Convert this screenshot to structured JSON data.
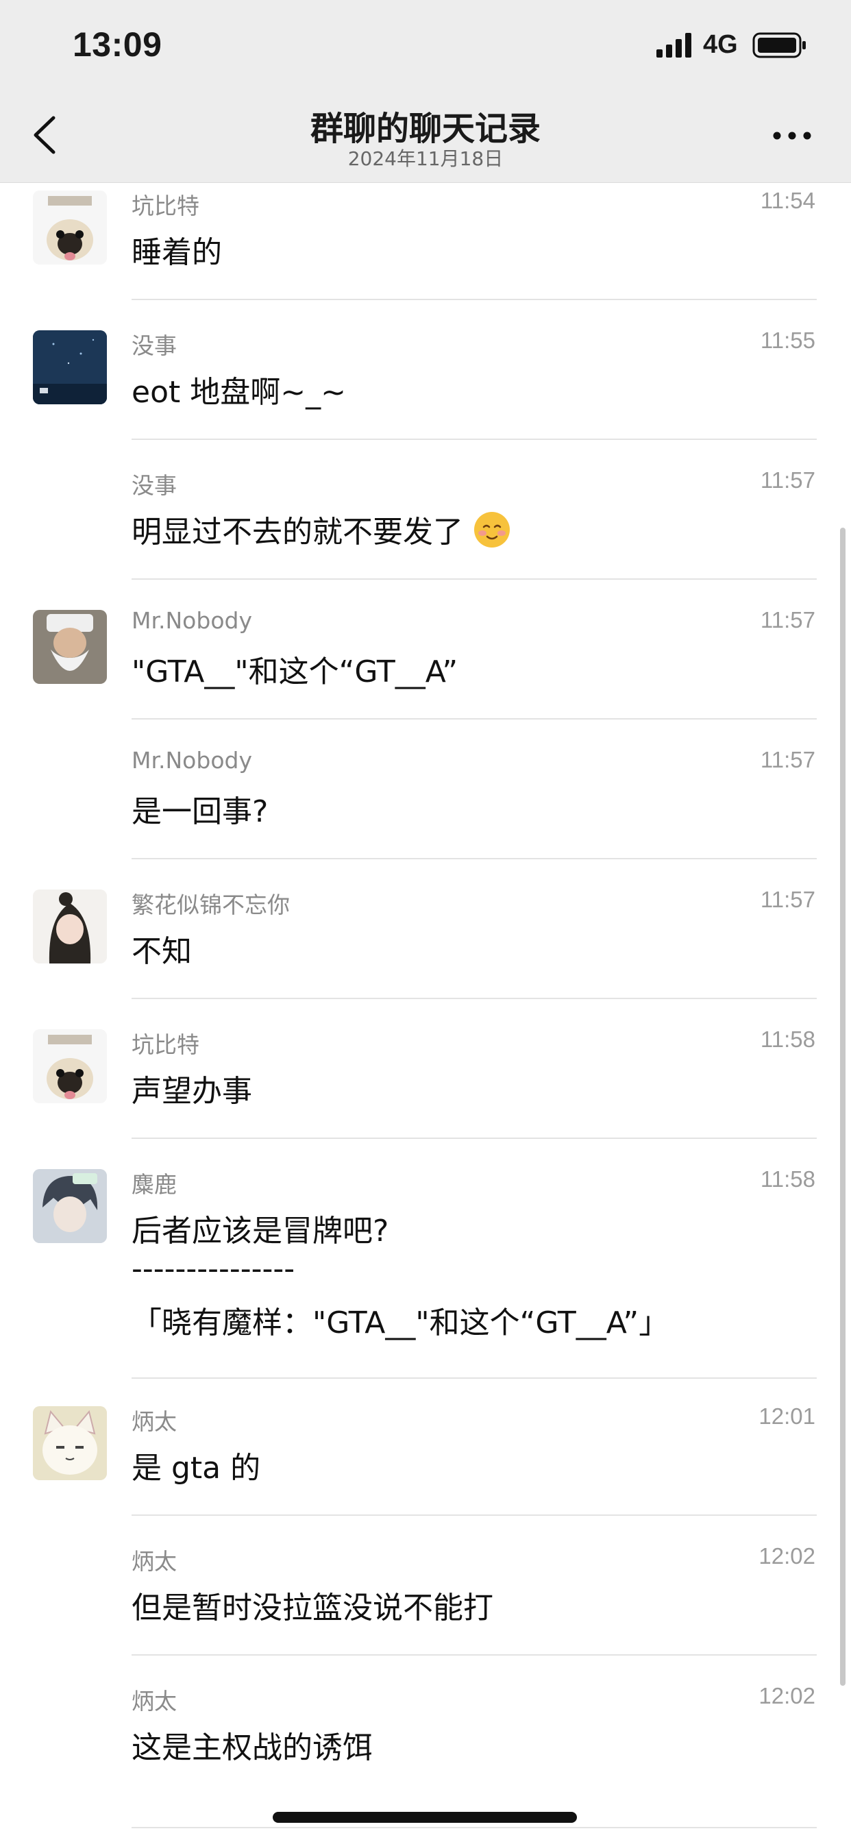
{
  "status_bar": {
    "time": "13:09",
    "network": "4G"
  },
  "nav": {
    "title": "群聊的聊天记录",
    "subtitle": "2024年11月18日"
  },
  "messages": [
    {
      "sender": "坑比特",
      "time": "11:54",
      "text": "睡着的",
      "avatar": "pug-sticker-avatar"
    },
    {
      "sender": "没事",
      "time": "11:55",
      "text": "eot 地盘啊~_~",
      "avatar": "night-sky-avatar"
    },
    {
      "sender": "没事",
      "time": "11:57",
      "text": "明显过不去的就不要发了",
      "emoji": "smiling-face-emoji"
    },
    {
      "sender": "Mr.Nobody",
      "time": "11:57",
      "text": "\"GTA__\"和这个“GT__A”",
      "avatar": "old-man-avatar"
    },
    {
      "sender": "Mr.Nobody",
      "time": "11:57",
      "text": "是一回事?"
    },
    {
      "sender": "繁花似锦不忘你",
      "time": "11:57",
      "text": "不知",
      "avatar": "girl-avatar"
    },
    {
      "sender": "坑比特",
      "time": "11:58",
      "text": "声望办事",
      "avatar": "pug-sticker-avatar"
    },
    {
      "sender": "麋鹿",
      "time": "11:58",
      "text": "后者应该是冒牌吧?",
      "line2": "---------------",
      "line3": "「晓有魔样：\"GTA__\"和这个“GT__A”」",
      "avatar": "anime-boy-avatar"
    },
    {
      "sender": "炳太",
      "time": "12:01",
      "text": "是 gta 的",
      "avatar": "cartoon-cat-avatar"
    },
    {
      "sender": "炳太",
      "time": "12:02",
      "text": "但是暂时没拉篮没说不能打"
    },
    {
      "sender": "炳太",
      "time": "12:02",
      "text": "这是主权战的诱饵"
    }
  ]
}
